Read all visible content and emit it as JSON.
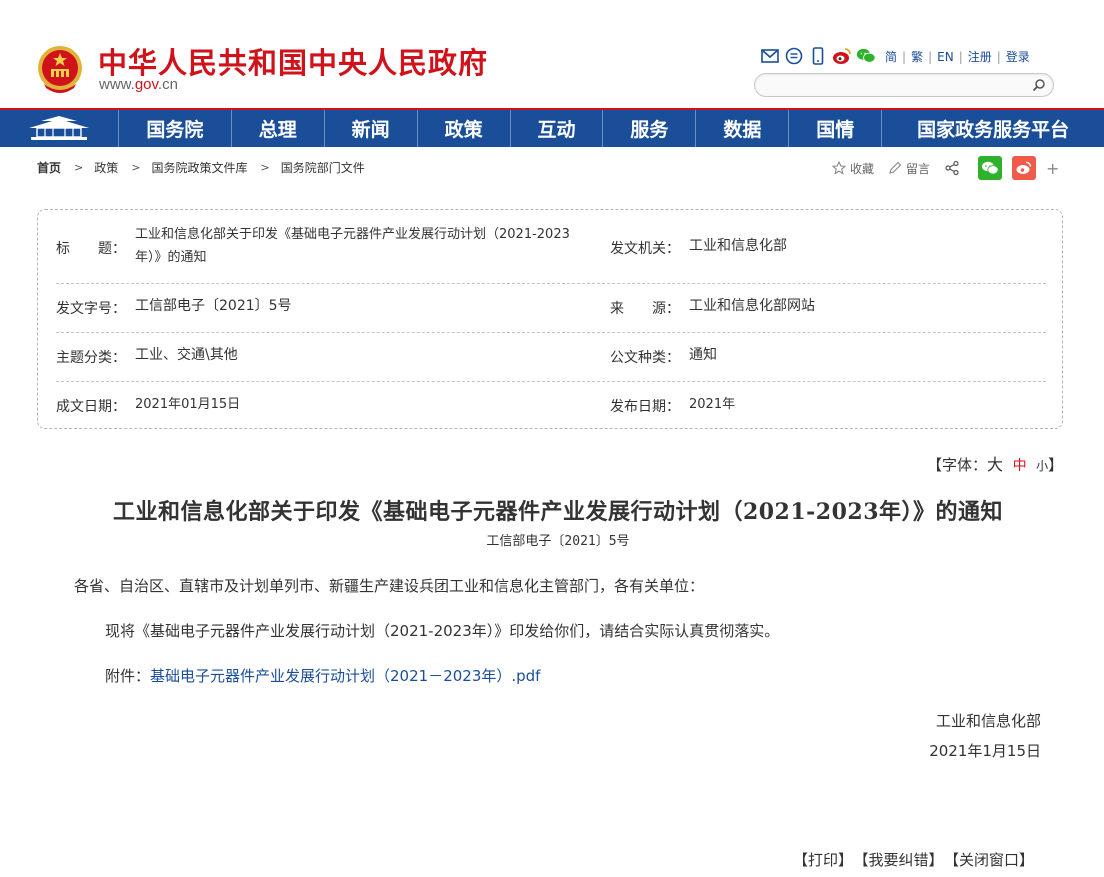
{
  "header": {
    "site_title": "中华人民共和国中央人民政府",
    "url_prefix": "www.",
    "url_domain": "gov",
    "url_suffix": ".cn",
    "tools": [
      "mail-icon",
      "message-icon",
      "mobile-icon",
      "weibo-icon",
      "wechat-icon"
    ],
    "lang_links": [
      "简",
      "繁",
      "EN",
      "注册",
      "登录"
    ],
    "search_placeholder": ""
  },
  "nav": {
    "items": [
      "国务院",
      "总理",
      "新闻",
      "政策",
      "互动",
      "服务",
      "数据",
      "国情",
      "国家政务服务平台"
    ]
  },
  "breadcrumb": {
    "items": [
      "首页",
      "政策",
      "国务院政策文件库",
      "国务院部门文件"
    ],
    "arrow": ">"
  },
  "share": {
    "favorite": "收藏",
    "comment": "留言",
    "more": "+"
  },
  "info": {
    "title_label": "标　　题：",
    "title_value_line1": "工业和信息化部关于印发《基础电子元器件产业发展行动计划（2021-2023",
    "title_value_line2": "年）》的通知",
    "issuer_label": "发文机关：",
    "issuer_value": "工业和信息化部",
    "docno_label": "发文字号：",
    "docno_value": "工信部电子〔2021〕5号",
    "source_label": "来　　源：",
    "source_value": "工业和信息化部网站",
    "topic_label": "主题分类：",
    "topic_value": "工业、交通\\其他",
    "type_label": "公文种类：",
    "type_value": "通知",
    "written_label": "成文日期：",
    "written_value": "2021年01月15日",
    "published_label": "发布日期：",
    "published_value": "2021年"
  },
  "fontsize": {
    "prefix": "【字体：",
    "big": "大",
    "mid": "中",
    "small": "小",
    "suffix": "】"
  },
  "doc": {
    "title": "工业和信息化部关于印发《基础电子元器件产业发展行动计划（2021-2023年）》的通知",
    "number": "工信部电子〔2021〕5号",
    "salutation": "各省、自治区、直辖市及计划单列市、新疆生产建设兵团工业和信息化主管部门，各有关单位：",
    "paragraph": "现将《基础电子元器件产业发展行动计划（2021-2023年）》印发给你们，请结合实际认真贯彻落实。",
    "attachment_label": "附件：",
    "attachment_link": "基础电子元器件产业发展行动计划（2021－2023年）.pdf",
    "signer": "工业和信息化部",
    "date": "2021年1月15日"
  },
  "bottom": {
    "print": "【打印】",
    "report_error": "【我要纠错】",
    "close_window": "【关闭窗口】"
  },
  "colors": {
    "brand_red": "#d0121b",
    "nav_blue": "#1a4e99",
    "wechat_green": "#2fb12c",
    "weibo_orange": "#f05a4b"
  }
}
